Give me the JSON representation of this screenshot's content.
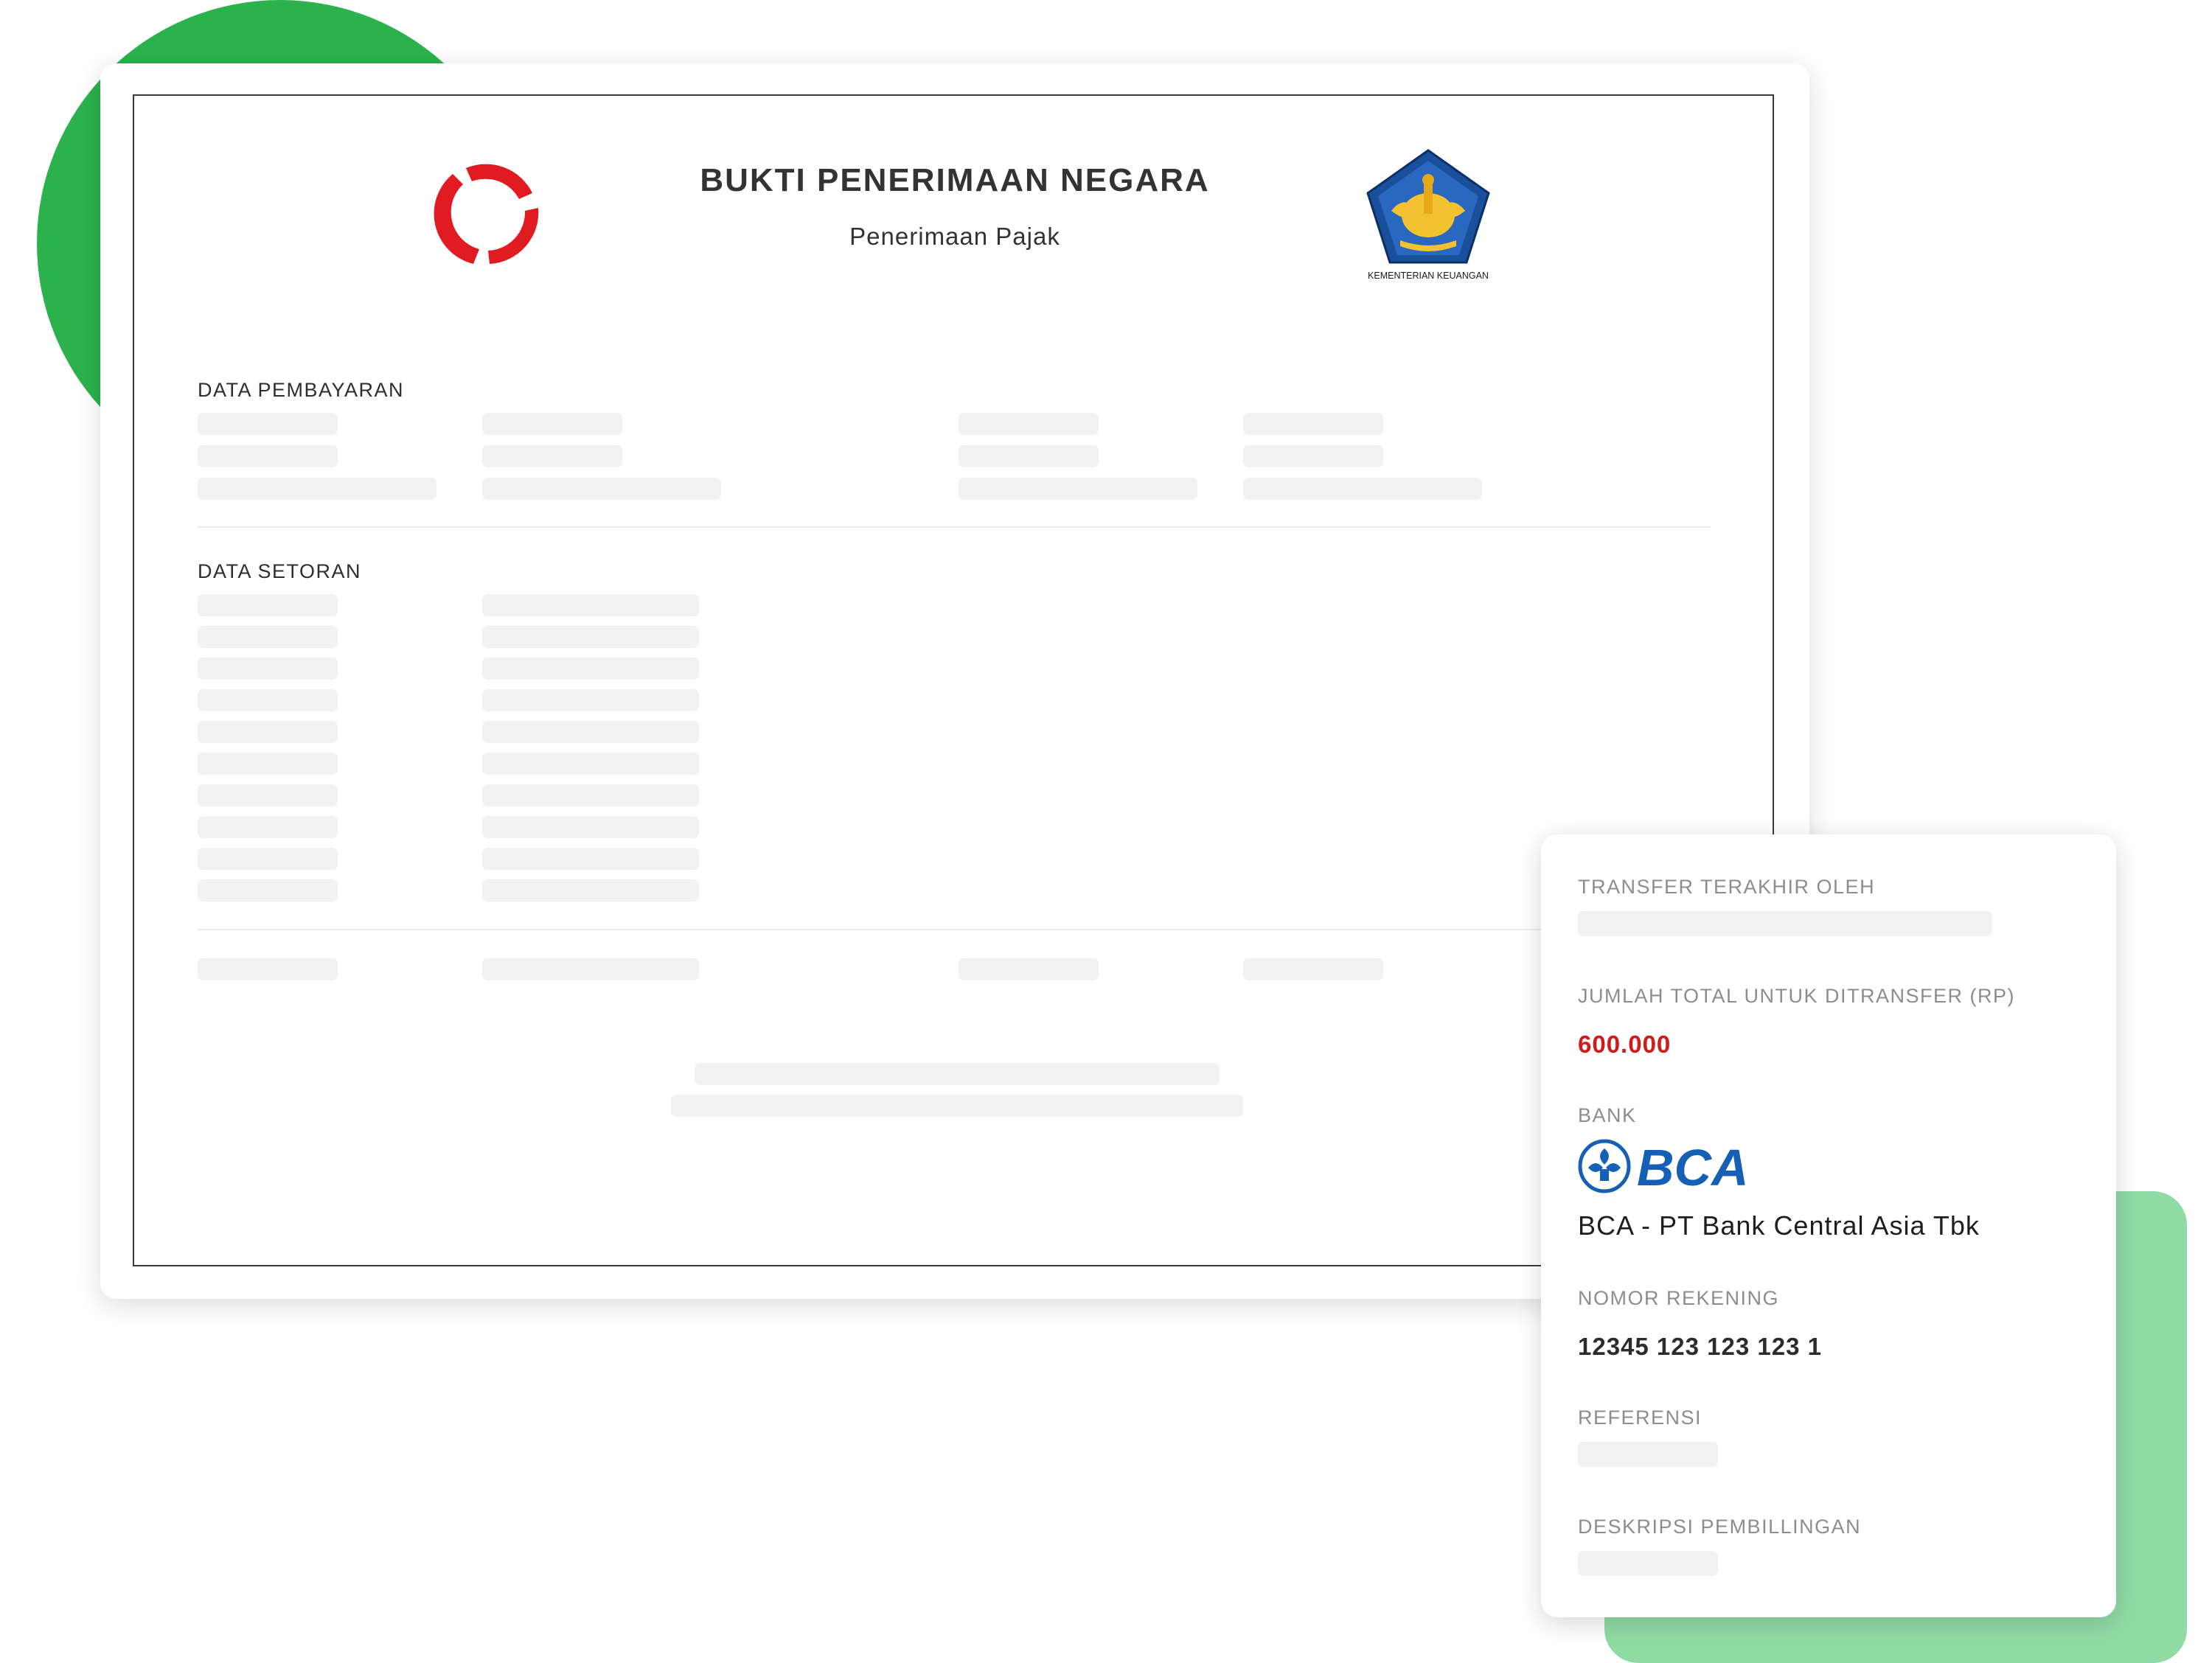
{
  "document": {
    "title": "BUKTI PENERIMAAN NEGARA",
    "subtitle": "Penerimaan Pajak",
    "ministry_logo_text": "KEMENTERIAN KEUANGAN",
    "sections": {
      "payment_data": "DATA PEMBAYARAN",
      "deposit_data": "DATA SETORAN"
    }
  },
  "panel": {
    "last_transfer_by_label": "TRANSFER TERAKHIR OLEH",
    "total_amount_label": "JUMLAH TOTAL UNTUK DITRANSFER (RP)",
    "total_amount": "600.000",
    "bank_label": "BANK",
    "bank_logo_text": "BCA",
    "bank_name": "BCA - PT Bank Central Asia Tbk",
    "account_number_label": "NOMOR REKENING",
    "account_number": "12345 123 123 123 1",
    "reference_label": "REFERENSI",
    "billing_description_label": "DESKRIPSI PEMBILLINGAN"
  },
  "colors": {
    "accent_green": "#2bb24c",
    "light_green": "#90dba4",
    "amount_red": "#d11a1a",
    "bca_blue": "#1560b5",
    "logo_red": "#e01b22"
  }
}
